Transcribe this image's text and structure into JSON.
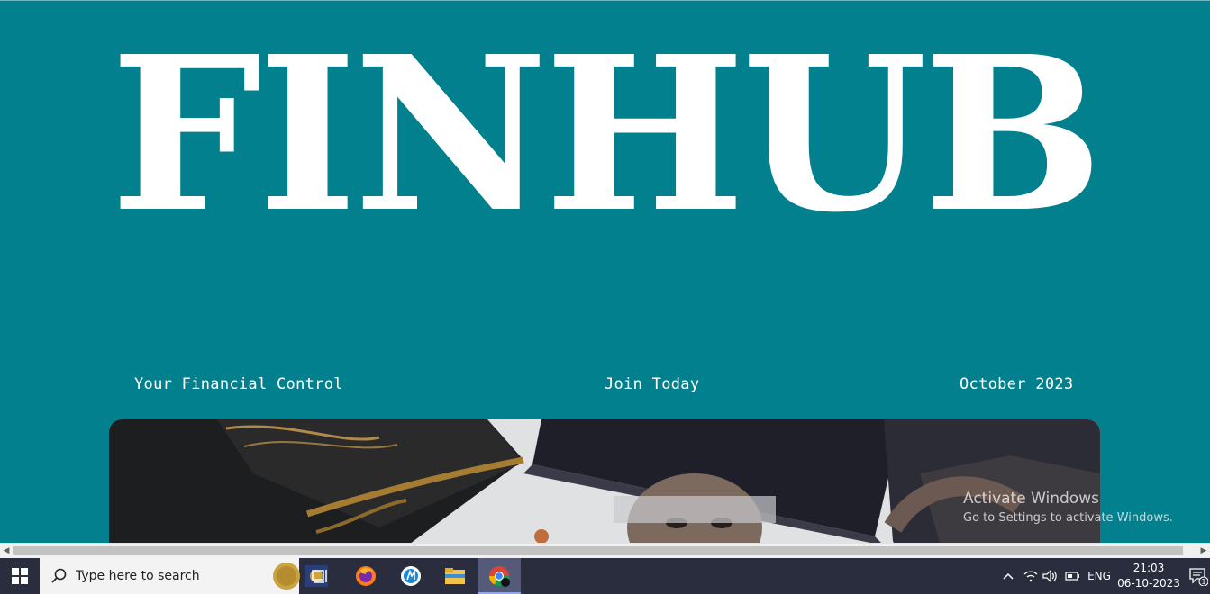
{
  "site": {
    "logo": "FINHUB",
    "strip": {
      "left": "Your Financial Control",
      "center": "Join Today",
      "right": "October 2023"
    },
    "hero_image": "graduates-looking-down-photo"
  },
  "watermark": {
    "title": "Activate Windows",
    "subtitle": "Go to Settings to activate Windows."
  },
  "taskbar": {
    "search_placeholder": "Type here to search",
    "language": "ENG",
    "time": "21:03",
    "date": "06-10-2023",
    "notification_count": "1"
  },
  "colors": {
    "page_bg": "#03808e",
    "logo": "#ffffff",
    "taskbar_bg": "#2a2d3e"
  }
}
